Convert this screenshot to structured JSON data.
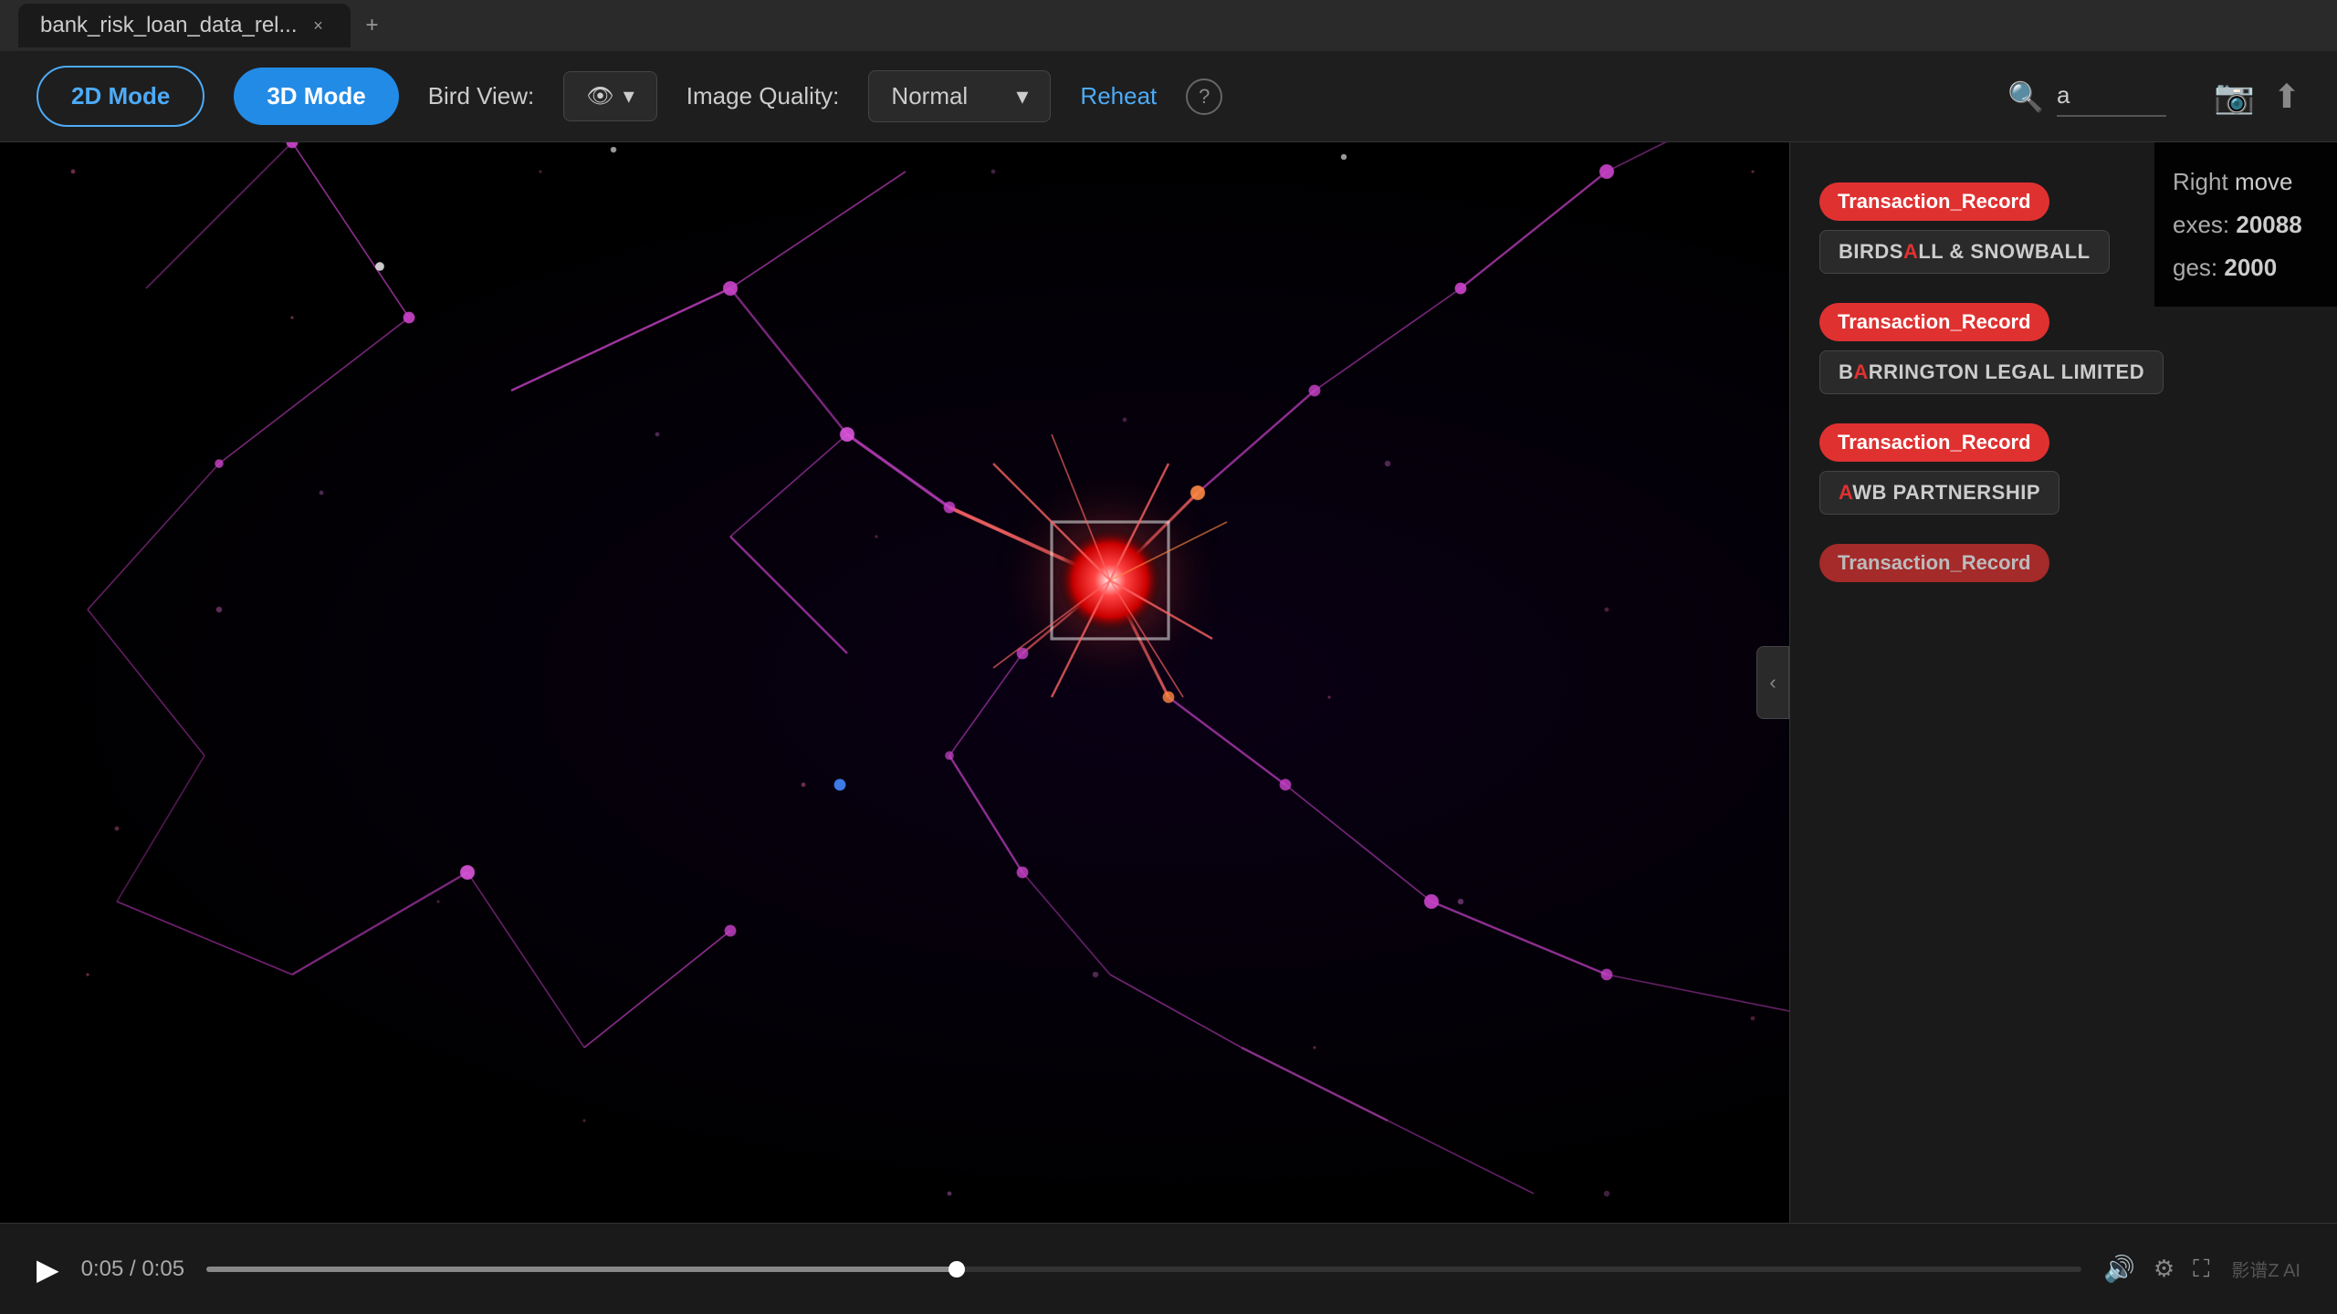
{
  "tab": {
    "title": "bank_risk_loan_data_rel...",
    "close_label": "×",
    "new_tab_label": "+"
  },
  "toolbar": {
    "mode_2d_label": "2D Mode",
    "mode_3d_label": "3D Mode",
    "bird_view_label": "Bird View:",
    "image_quality_label": "Image Quality:",
    "image_quality_value": "Normal",
    "reheat_label": "Reheat",
    "help_label": "?",
    "search_placeholder": "a",
    "camera_icon": "📷",
    "share_icon": "↑"
  },
  "stats": {
    "vertices_label": "exes:",
    "vertices_value": "20088",
    "edges_label": "ges:",
    "edges_value": "2000"
  },
  "search_results": [
    {
      "badge": "Transaction_Record",
      "name": "BIRDSALL & SNOWBALL",
      "highlight_char": "A"
    },
    {
      "badge": "Transaction_Record",
      "name": "BARRINGTON LEGAL LIMITED",
      "highlight_char": "A"
    },
    {
      "badge": "Transaction_Record",
      "name": "AWB PARTNERSHIP",
      "highlight_char": "A"
    }
  ],
  "right_panel": {
    "direction_label": "Right",
    "move_label": "move"
  },
  "playbar": {
    "time_current": "0:05",
    "time_total": "0:05",
    "time_display": "0:05 / 0:05",
    "logo": "影谱Z AI"
  }
}
